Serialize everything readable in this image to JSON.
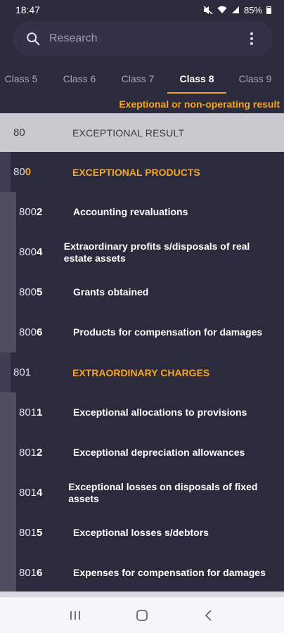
{
  "status_bar": {
    "time": "18:47",
    "battery_level": "85%"
  },
  "search": {
    "placeholder": "Research"
  },
  "tabs": [
    {
      "label": "Class 5",
      "active": false
    },
    {
      "label": "Class 6",
      "active": false
    },
    {
      "label": "Class 7",
      "active": false
    },
    {
      "label": "Class 8",
      "active": true
    },
    {
      "label": "Class 9",
      "active": false
    }
  ],
  "section_subtitle": "Exeptional or non-operating result",
  "class_row": {
    "code": "80",
    "label": "EXCEPTIONAL RESULT"
  },
  "groups": [
    {
      "code_prefix": "80",
      "code_suffix": "0",
      "label": "EXCEPTIONAL PRODUCTS",
      "accounts": [
        {
          "code_prefix": "800",
          "code_suffix": "2",
          "label": "Accounting revaluations"
        },
        {
          "code_prefix": "800",
          "code_suffix": "4",
          "label": "Extraordinary profits s/disposals of real estate assets"
        },
        {
          "code_prefix": "800",
          "code_suffix": "5",
          "label": "Grants obtained"
        },
        {
          "code_prefix": "800",
          "code_suffix": "6",
          "label": "Products for compensation for damages"
        }
      ]
    },
    {
      "code_prefix": "801",
      "code_suffix": "",
      "label": "EXTRAORDINARY CHARGES",
      "accounts": [
        {
          "code_prefix": "801",
          "code_suffix": "1",
          "label": "Exceptional allocations to provisions"
        },
        {
          "code_prefix": "801",
          "code_suffix": "2",
          "label": "Exceptional depreciation allowances"
        },
        {
          "code_prefix": "801",
          "code_suffix": "4",
          "label": "Exceptional losses on disposals of fixed assets"
        },
        {
          "code_prefix": "801",
          "code_suffix": "5",
          "label": "Exceptional losses s/debtors"
        },
        {
          "code_prefix": "801",
          "code_suffix": "6",
          "label": "Expenses for compensation for damages"
        }
      ]
    }
  ],
  "colors": {
    "background": "#2c2a3d",
    "accent": "#f6a623",
    "class_row_bg": "#c9c9cf"
  }
}
